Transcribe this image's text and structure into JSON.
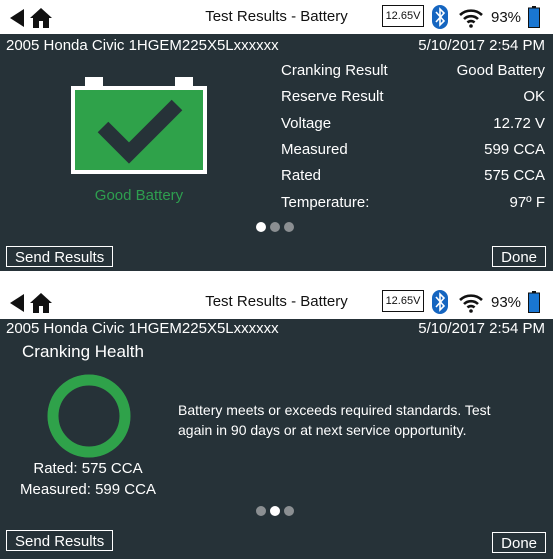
{
  "screen1": {
    "title": "Test Results - Battery",
    "voltage_display": "12.65V",
    "battery_percent": "93%",
    "vehicle": "2005 Honda Civic 1HGEM225X5Lxxxxxx",
    "datetime": "5/10/2017  2:54 PM",
    "status_label": "Good Battery",
    "results": [
      {
        "label": "Cranking Result",
        "value": "Good Battery"
      },
      {
        "label": "Reserve Result",
        "value": "OK"
      },
      {
        "label": "Voltage",
        "value": "12.72 V"
      },
      {
        "label": "Measured",
        "value": "599 CCA"
      },
      {
        "label": "Rated",
        "value": "575 CCA"
      },
      {
        "label": "Temperature:",
        "value": "97º F"
      }
    ],
    "page_indicator": {
      "count": 3,
      "active_index": 0
    },
    "send_button": "Send Results",
    "done_button": "Done"
  },
  "screen2": {
    "title": "Test Results - Battery",
    "voltage_display": "12.65V",
    "battery_percent": "93%",
    "vehicle": "2005 Honda Civic 1HGEM225X5Lxxxxxx",
    "datetime": "5/10/2017  2:54 PM",
    "heading": "Cranking Health",
    "rated": "Rated: 575 CCA",
    "measured": "Measured: 599 CCA",
    "message_line1": "Battery meets or exceeds required standards. Test",
    "message_line2": "again in 90 days or at next service opportunity.",
    "health_fraction": 1.0,
    "page_indicator": {
      "count": 3,
      "active_index": 1
    },
    "send_button": "Send Results",
    "done_button": "Done"
  },
  "colors": {
    "background": "#263238",
    "good_green": "#2fa24a",
    "status_text_green": "#2e9e4f",
    "bluetooth_blue": "#1565c0",
    "battery_icon_blue": "#1976d2"
  },
  "icons": [
    "back-arrow-icon",
    "home-icon",
    "bluetooth-icon",
    "wifi-icon",
    "battery-icon",
    "checkmark-icon"
  ]
}
